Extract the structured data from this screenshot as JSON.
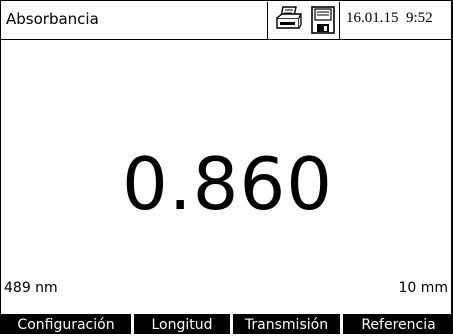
{
  "header": {
    "title": "Absorbancia",
    "datetime": "16.01.15  9:52",
    "icons": [
      "printer-icon",
      "save-icon"
    ]
  },
  "measurement": {
    "value": "0.860",
    "wavelength": "489 nm",
    "path_length": "10 mm"
  },
  "softkeys": [
    "Configuración",
    "Longitud",
    "Transmisión",
    "Referencia"
  ]
}
